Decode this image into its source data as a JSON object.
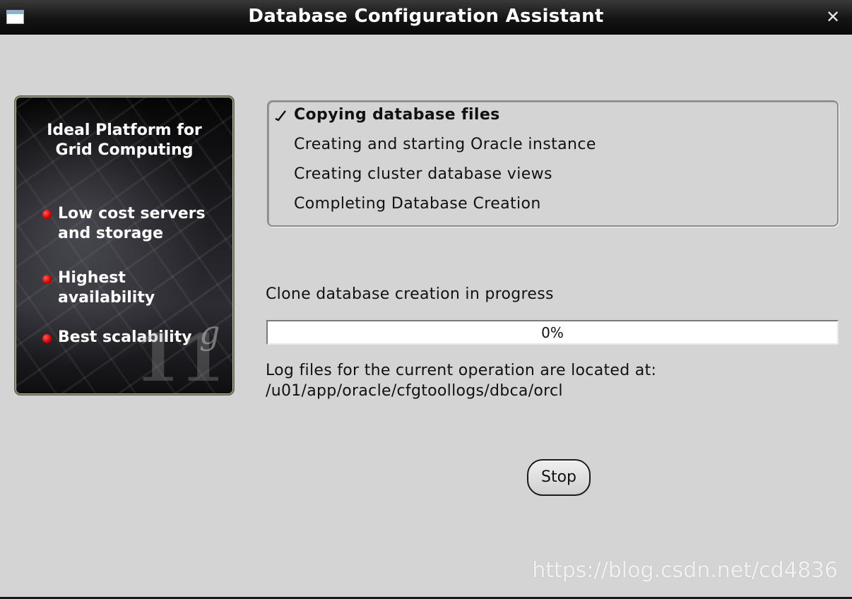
{
  "window": {
    "title": "Database Configuration Assistant",
    "close_symbol": "✕"
  },
  "promo": {
    "heading_lines": [
      "Ideal Platform for",
      "Grid Computing"
    ],
    "items": [
      {
        "lines": [
          "Low cost servers",
          "and storage"
        ]
      },
      {
        "lines": [
          "Highest availability"
        ]
      },
      {
        "lines": [
          "Best scalability"
        ]
      }
    ],
    "logo_number": "11",
    "logo_letter": "g",
    "bullet_color": "#e00000"
  },
  "steps": [
    {
      "label": "Copying database files",
      "state": "in-progress"
    },
    {
      "label": "Creating and starting Oracle instance",
      "state": "pending"
    },
    {
      "label": "Creating cluster database views",
      "state": "pending"
    },
    {
      "label": "Completing Database Creation",
      "state": "pending"
    }
  ],
  "progress": {
    "status_text": "Clone database creation in progress",
    "percent_label": "0%",
    "fraction": 0
  },
  "log": {
    "line1": "Log files for the current operation are located at:",
    "line2": "/u01/app/oracle/cfgtoollogs/dbca/orcl"
  },
  "buttons": {
    "stop_label": "Stop"
  },
  "watermark": "https://blog.csdn.net/cd4836"
}
